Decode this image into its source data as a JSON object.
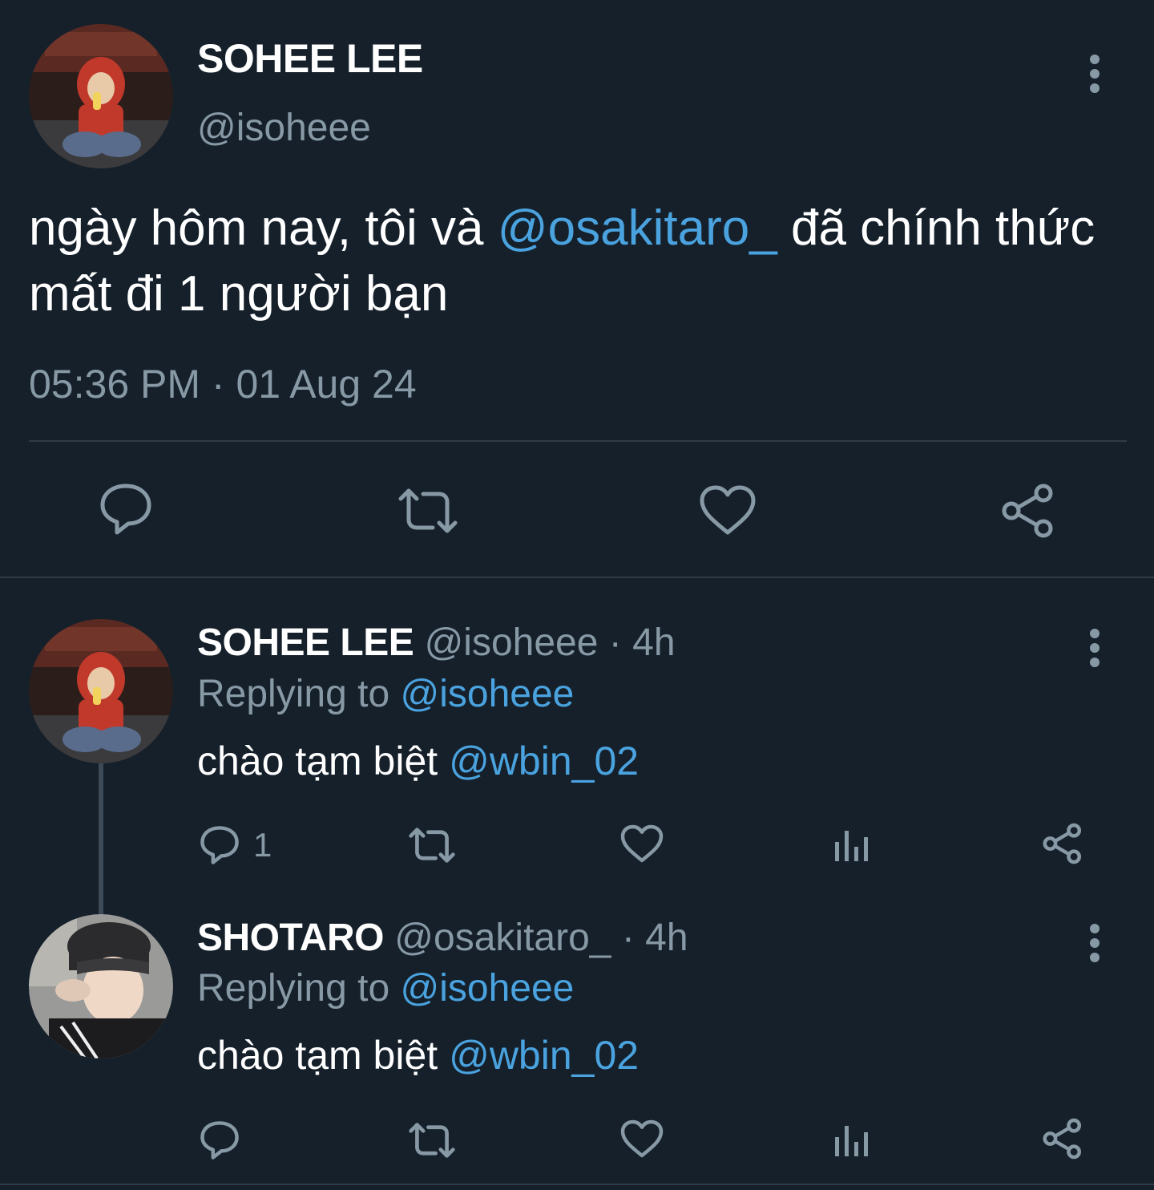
{
  "main_tweet": {
    "author_name": "SOHEE LEE",
    "author_handle": "@isoheee",
    "text_part1": "ngày hôm nay, tôi và ",
    "mention": "@osakitaro_",
    "text_part2": " đã chính thức mất đi 1 người bạn",
    "timestamp": "05:36 PM · 01 Aug 24",
    "actions": [
      "reply-icon",
      "retweet-icon",
      "like-icon",
      "share-icon"
    ]
  },
  "replies": [
    {
      "author_name": "SOHEE LEE",
      "author_handle": "@isoheee",
      "time": "· 4h",
      "replying_label": "Replying to",
      "replying_to": "@isoheee",
      "text": "chào tạm biệt ",
      "mention": "@wbin_02",
      "reply_count": "1"
    },
    {
      "author_name": "SHOTARO",
      "author_handle": "@osakitaro_",
      "time": "· 4h",
      "replying_label": "Replying to",
      "replying_to": "@isoheee",
      "text": "chào tạm biệt ",
      "mention": "@wbin_02",
      "reply_count": ""
    }
  ],
  "colors": {
    "background": "#15202b",
    "muted": "#8899a6",
    "link": "#4aa3df",
    "divider": "#2f3b47"
  }
}
